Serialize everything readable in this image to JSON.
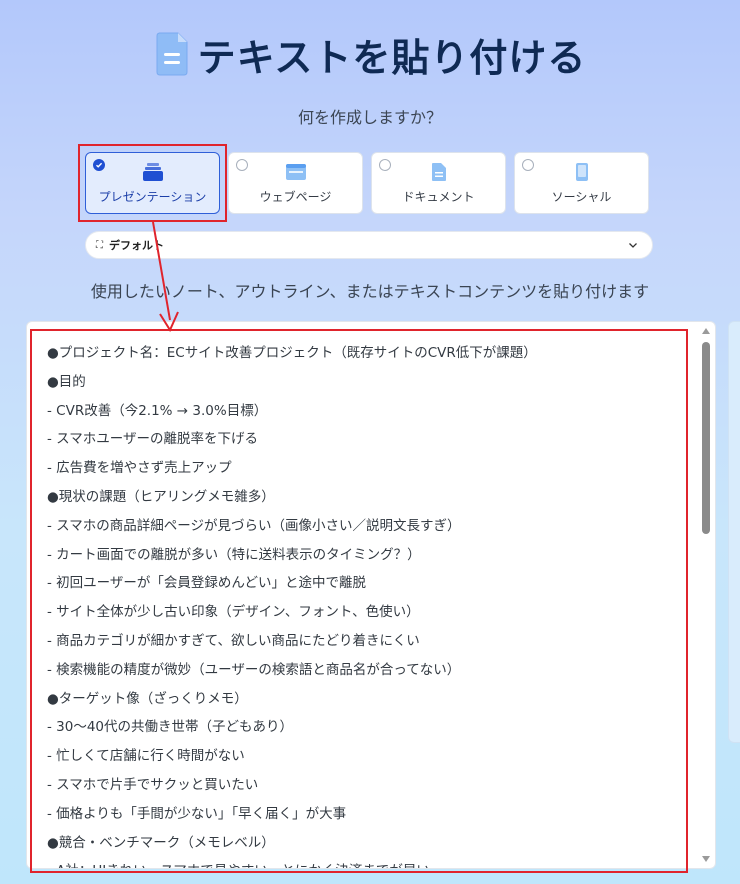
{
  "header": {
    "title": "テキストを貼り付ける",
    "icon": "document-icon"
  },
  "question": "何を作成しますか？",
  "content_types": [
    {
      "label": "プレゼンテーション",
      "selected": true,
      "icon": "slides-icon"
    },
    {
      "label": "ウェブページ",
      "selected": false,
      "icon": "browser-window-icon"
    },
    {
      "label": "ドキュメント",
      "selected": false,
      "icon": "document-icon"
    },
    {
      "label": "ソーシャル",
      "selected": false,
      "icon": "phone-icon"
    }
  ],
  "theme_dropdown": {
    "value": "デフォルト",
    "icon": "theme-frame-icon"
  },
  "instruction": "使用したいノート、アウトライン、またはテキストコンテンツを貼り付けます",
  "editor": {
    "lines": [
      "●プロジェクト名：ECサイト改善プロジェクト（既存サイトのCVR低下が課題）",
      "●目的",
      "- CVR改善（今2.1% → 3.0%目標）",
      "- スマホユーザーの離脱率を下げる",
      "- 広告費を増やさず売上アップ",
      "●現状の課題（ヒアリングメモ雑多）",
      "- スマホの商品詳細ページが見づらい（画像小さい／説明文長すぎ）",
      "- カート画面での離脱が多い（特に送料表示のタイミング？）",
      "- 初回ユーザーが「会員登録めんどい」と途中で離脱",
      "- サイト全体が少し古い印象（デザイン、フォント、色使い）",
      "- 商品カテゴリが細かすぎて、欲しい商品にたどり着きにくい",
      "- 検索機能の精度が微妙（ユーザーの検索語と商品名が合ってない）",
      "●ターゲット像（ざっくりメモ）",
      "- 30〜40代の共働き世帯（子どもあり）",
      "- 忙しくて店舗に行く時間がない",
      "- スマホで片手でサクッと買いたい",
      "- 価格よりも「手間が少ない」「早く届く」が大事",
      "●競合・ベンチマーク（メモレベル）",
      "- A社：UIきれい、スマホで見やすい、とにかく決済までが早い"
    ]
  },
  "colors": {
    "accent": "#1f4fd2",
    "title": "#0f2a54",
    "highlight": "#e0242c"
  }
}
